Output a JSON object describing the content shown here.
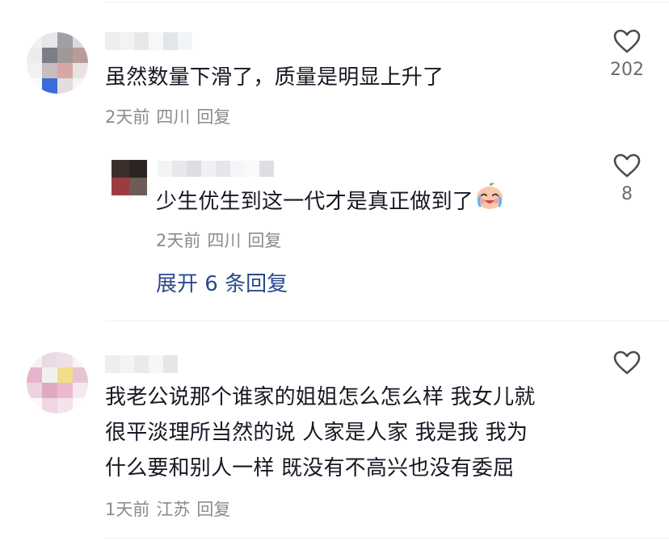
{
  "comments": [
    {
      "text": "虽然数量下滑了，质量是明显上升了",
      "time": "2天前",
      "location": "四川",
      "reply_label": "回复",
      "likes": "202",
      "replies": [
        {
          "text": "少生优生到这一代才是真正做到了",
          "emoji": "crying-laughing-emoji",
          "time": "2天前",
          "location": "四川",
          "reply_label": "回复",
          "likes": "8"
        }
      ],
      "expand_label": "展开 6 条回复"
    },
    {
      "text_lines": [
        "我老公说那个谁家的姐姐怎么怎么样 我女儿就",
        "很平淡理所当然的说 人家是人家 我是我 我为",
        "什么要和别人一样 既没有不高兴也没有委屈"
      ],
      "time": "1天前",
      "location": "江苏",
      "reply_label": "回复"
    }
  ],
  "colors": {
    "text": "#161823",
    "meta": "#8a8b91",
    "link": "#2a4a8c",
    "divider": "#eceef1"
  },
  "icons": [
    "heart-outline-icon"
  ]
}
